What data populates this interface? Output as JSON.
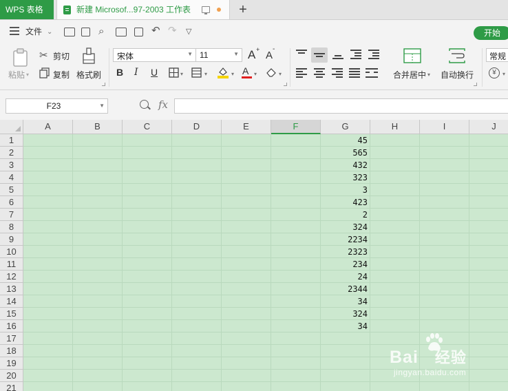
{
  "titlebar": {
    "app_name": "WPS 表格",
    "doc_title": "新建 Microsof...97-2003 工作表",
    "new_tab": "+"
  },
  "quickbar": {
    "file_menu": "文件",
    "start_tab": "开始"
  },
  "ribbon": {
    "paste": "粘贴",
    "cut": "剪切",
    "copy": "复制",
    "format_painter": "格式刷",
    "font_name": "宋体",
    "font_size": "11",
    "grow_font": "A",
    "shrink_font": "A",
    "bold": "B",
    "italic": "I",
    "underline": "U",
    "font_color_letter": "A",
    "merge_center": "合并居中",
    "wrap_text": "自动换行",
    "number_format": "常规",
    "currency_symbol": "¥",
    "accent_color": "#2e9b46",
    "font_color": "#e02020",
    "fill_color": "#f5d400"
  },
  "formula_bar": {
    "cell_ref": "F23",
    "fx_label": "fx",
    "formula": ""
  },
  "sheet": {
    "columns": [
      "A",
      "B",
      "C",
      "D",
      "E",
      "F",
      "G",
      "H",
      "I",
      "J"
    ],
    "selected_column": "F",
    "rows": [
      "1",
      "2",
      "3",
      "4",
      "5",
      "6",
      "7",
      "8",
      "9",
      "10",
      "11",
      "12",
      "13",
      "14",
      "15",
      "16",
      "17",
      "18",
      "19",
      "20",
      "21"
    ],
    "column_g_values": [
      "45",
      "565",
      "432",
      "323",
      "3",
      "423",
      "2",
      "324",
      "2234",
      "2323",
      "234",
      "24",
      "2344",
      "34",
      "324",
      "34"
    ],
    "fill_color": "#cce8cf"
  },
  "watermark": {
    "brand": "Bai",
    "brand_cn": "经验",
    "url": "jingyan.baidu.com"
  }
}
